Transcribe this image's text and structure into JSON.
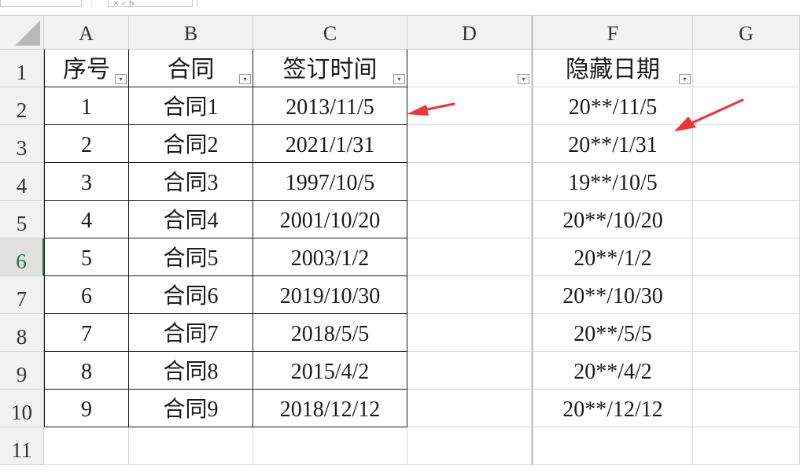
{
  "formula_bar": {
    "name_box": "",
    "separator": "⋮",
    "icons": "✕ ✓ fx",
    "formula": ""
  },
  "columns": [
    "A",
    "B",
    "C",
    "D",
    "F",
    "G"
  ],
  "rows": [
    "1",
    "2",
    "3",
    "4",
    "5",
    "6",
    "7",
    "8",
    "9",
    "10",
    "11"
  ],
  "active_row": "6",
  "table": {
    "headers": {
      "seq": "序号",
      "contract": "合同",
      "sign_time": "签订时间",
      "hidden_date": "隐藏日期"
    },
    "rows": [
      {
        "seq": "1",
        "contract": "合同1",
        "date": "2013/11/5",
        "hidden": "20**/11/5"
      },
      {
        "seq": "2",
        "contract": "合同2",
        "date": "2021/1/31",
        "hidden": "20**/1/31"
      },
      {
        "seq": "3",
        "contract": "合同3",
        "date": "1997/10/5",
        "hidden": "19**/10/5"
      },
      {
        "seq": "4",
        "contract": "合同4",
        "date": "2001/10/20",
        "hidden": "20**/10/20"
      },
      {
        "seq": "5",
        "contract": "合同5",
        "date": "2003/1/2",
        "hidden": "20**/1/2"
      },
      {
        "seq": "6",
        "contract": "合同6",
        "date": "2019/10/30",
        "hidden": "20**/10/30"
      },
      {
        "seq": "7",
        "contract": "合同7",
        "date": "2018/5/5",
        "hidden": "20**/5/5"
      },
      {
        "seq": "8",
        "contract": "合同8",
        "date": "2015/4/2",
        "hidden": "20**/4/2"
      },
      {
        "seq": "9",
        "contract": "合同9",
        "date": "2018/12/12",
        "hidden": "20**/12/12"
      }
    ]
  },
  "filter_icon": "▾",
  "colors": {
    "arrow": "#e8363a",
    "accent": "#217346",
    "header_bg": "#f2f2f2"
  }
}
